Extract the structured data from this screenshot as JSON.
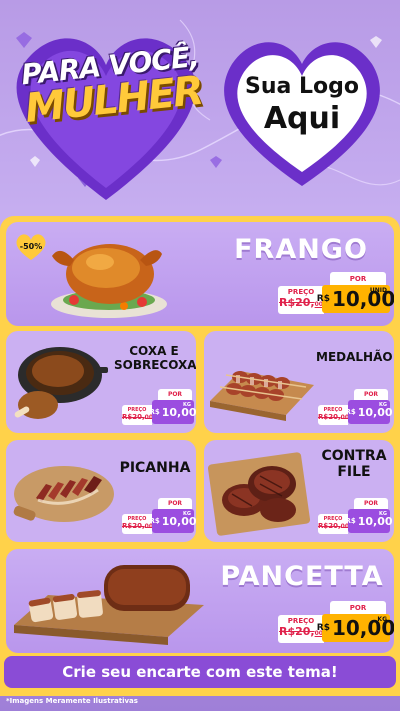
{
  "header": {
    "promo_title_line1": "PARA VOCÊ,",
    "promo_title_line2": "MULHER",
    "logo_line1": "Sua Logo",
    "logo_line2": "Aqui"
  },
  "colors": {
    "background": "#b89be6",
    "board": "#ffd24a",
    "card": "#cbb0f2",
    "price_big": "#ffb300",
    "price_small": "#9b4de0",
    "footer": "#8a4cd6",
    "strike": "#e0224b"
  },
  "products": {
    "frango": {
      "name": "FRANGO",
      "badge": "-50%",
      "old_label": "PREÇO",
      "old_price": "R$20,",
      "old_cents": "00",
      "por_label": "POR",
      "currency": "R$",
      "price": "10,00",
      "unit": "UNID",
      "icon": "roast-chicken-image"
    },
    "coxa": {
      "name_line1": "COXA E",
      "name_line2": "SOBRECOXA",
      "old_label": "PREÇO",
      "old_price": "R$20,",
      "old_cents": "00",
      "por_label": "POR",
      "currency": "R$",
      "price": "10,00",
      "unit": "KG",
      "icon": "chicken-leg-image"
    },
    "medalhao": {
      "name": "MEDALHÃO",
      "old_label": "PREÇO",
      "old_price": "R$20,",
      "old_cents": "00",
      "por_label": "POR",
      "currency": "R$",
      "price": "10,00",
      "unit": "KG",
      "icon": "medallion-skewers-image"
    },
    "picanha": {
      "name": "PICANHA",
      "old_label": "PREÇO",
      "old_price": "R$20,",
      "old_cents": "00",
      "por_label": "POR",
      "currency": "R$",
      "price": "10,00",
      "unit": "KG",
      "icon": "sliced-picanha-image"
    },
    "contrafile": {
      "name_line1": "CONTRA",
      "name_line2": "FILE",
      "old_label": "PREÇO",
      "old_price": "R$20,",
      "old_cents": "00",
      "por_label": "POR",
      "currency": "R$",
      "price": "10,00",
      "unit": "KG",
      "icon": "steaks-image"
    },
    "pancetta": {
      "name": "PANCETTA",
      "old_label": "PREÇO",
      "old_price": "R$20,",
      "old_cents": "00",
      "por_label": "POR",
      "currency": "R$",
      "price": "10,00",
      "unit": "KG",
      "icon": "pancetta-board-image"
    }
  },
  "footer": {
    "cta": "Crie seu encarte com este tema!",
    "disclaimer": "*Imagens Meramente Ilustrativas"
  }
}
